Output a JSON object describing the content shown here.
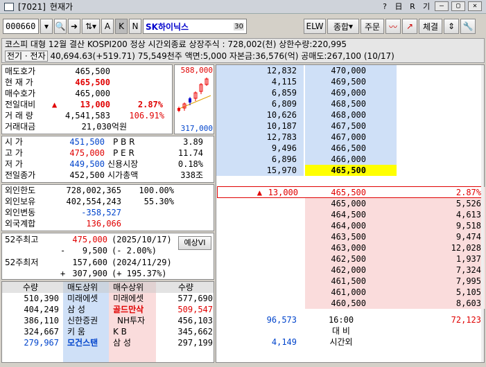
{
  "window": {
    "code_tag": "[7021]",
    "title": "현재가",
    "tools": [
      "?",
      "日",
      "R",
      "기"
    ],
    "win_buttons": [
      "—",
      "▢",
      "✕"
    ]
  },
  "toolbar": {
    "code": "000660",
    "name": "SK하이닉스",
    "btn_a": "A",
    "btn_k": "K",
    "btn_n": "N",
    "btn_30": "30",
    "elw": "ELW",
    "jonghap": "종합",
    "order": "주문",
    "chegyeol": "체결"
  },
  "info": {
    "line1": "코스피 대형 12월 결산 KOSPI200 정상   시간외종료  상장주식 : 728,002(천) 상한수량:220,995",
    "line2_tag": "전기 · 전자",
    "line2": "40,694.63(+519.71) 75,549천주 액면:5,000 자본금:36,576(억) 공매도:267,100 (10/17)"
  },
  "quote": {
    "rows": [
      {
        "label": "매도호가",
        "value": "465,500"
      },
      {
        "label": "현 재 가",
        "value": "465,500"
      },
      {
        "label": "매수호가",
        "value": "465,000"
      },
      {
        "label": "전일대비",
        "arrow": "▲",
        "value": "13,000",
        "pct": "2.87%"
      },
      {
        "label": "거 래 량",
        "value": "4,541,583",
        "pct": "106.91%"
      },
      {
        "label": "거래대금",
        "value": "21,030억원"
      }
    ],
    "chart_hi": "588,000",
    "chart_lo": "317,000"
  },
  "prices": {
    "left": [
      {
        "label": "시    가",
        "value": "451,500"
      },
      {
        "label": "고    가",
        "value": "475,000"
      },
      {
        "label": "저    가",
        "value": "449,500"
      },
      {
        "label": "전일종가",
        "value": "452,500"
      }
    ],
    "right": [
      {
        "label": "P B R",
        "value": "3.89"
      },
      {
        "label": "P E R",
        "value": "11.74"
      },
      {
        "label": "신용시장",
        "value": "0.18%"
      },
      {
        "label": "시가총액",
        "value": "338조"
      }
    ]
  },
  "foreign": [
    {
      "label": "외인한도",
      "value": "728,002,365",
      "extra": "100.00%"
    },
    {
      "label": "외인보유",
      "value": "402,554,243",
      "extra": "55.30%"
    },
    {
      "label": "외인변동",
      "value": "-358,527",
      "extra": ""
    },
    {
      "label": "외국계합",
      "value": "136,066",
      "extra": ""
    }
  ],
  "week52": {
    "hi_label": "52주최고",
    "hi_value": "475,000",
    "hi_date": "(2025/10/17)",
    "hi_diff_sign": "-",
    "hi_diff": "9,500",
    "hi_diff_pct": "(-   2.00%)",
    "lo_label": "52주최저",
    "lo_value": "157,600",
    "lo_date": "(2024/11/29)",
    "lo_diff_sign": "+",
    "lo_diff": "307,900",
    "lo_diff_pct": "(+ 195.37%)",
    "vi_button": "예상VI"
  },
  "brokers": {
    "headers": [
      "수량",
      "매도상위",
      "매수상위",
      "수량"
    ],
    "rows": [
      {
        "sell_qty": "510,390",
        "sell": "미래에셋",
        "buy": "미래에셋",
        "buy_qty": "577,690"
      },
      {
        "sell_qty": "404,249",
        "sell": "삼    성",
        "buy": "골드만삭",
        "buy_qty": "509,547"
      },
      {
        "sell_qty": "386,110",
        "sell": "신한증권",
        "buy": "NH투자",
        "buy_qty": "456,103"
      },
      {
        "sell_qty": "324,667",
        "sell": "키    움",
        "buy": "K     B",
        "buy_qty": "345,662"
      },
      {
        "sell_qty": "279,967",
        "sell": "모건스탠",
        "buy": "삼    성",
        "buy_qty": "297,199"
      }
    ]
  },
  "orderbook": {
    "asks": [
      {
        "qty": "12,832",
        "price": "470,000"
      },
      {
        "qty": "4,115",
        "price": "469,500"
      },
      {
        "qty": "6,859",
        "price": "469,000"
      },
      {
        "qty": "6,809",
        "price": "468,500"
      },
      {
        "qty": "10,626",
        "price": "468,000"
      },
      {
        "qty": "10,187",
        "price": "467,500"
      },
      {
        "qty": "12,783",
        "price": "467,000"
      },
      {
        "qty": "9,496",
        "price": "466,500"
      },
      {
        "qty": "6,896",
        "price": "466,000"
      },
      {
        "qty": "15,970",
        "price": "465,500"
      }
    ],
    "current": {
      "arrow": "▲",
      "change": "13,000",
      "price": "465,500",
      "pct": "2.87%"
    },
    "bids": [
      {
        "price": "465,000",
        "qty": "5,526"
      },
      {
        "price": "464,500",
        "qty": "4,613"
      },
      {
        "price": "464,000",
        "qty": "9,518"
      },
      {
        "price": "463,500",
        "qty": "9,474"
      },
      {
        "price": "463,000",
        "qty": "12,028"
      },
      {
        "price": "462,500",
        "qty": "1,937"
      },
      {
        "price": "462,000",
        "qty": "7,324"
      },
      {
        "price": "461,500",
        "qty": "7,995"
      },
      {
        "price": "461,000",
        "qty": "5,105"
      },
      {
        "price": "460,500",
        "qty": "8,603"
      }
    ],
    "footer": {
      "total_ask": "96,573",
      "time": "16:00",
      "total_bid": "72,123",
      "label_diff": "대  비",
      "after_qty": "4,149",
      "label_after": "시간외"
    }
  }
}
